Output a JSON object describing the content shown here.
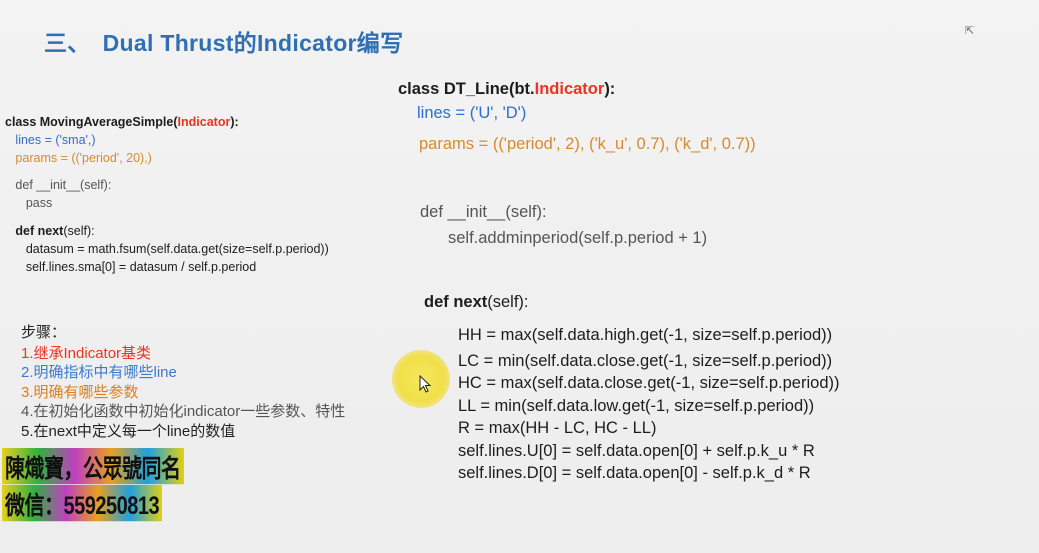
{
  "title": {
    "number": "三、",
    "text": "Dual Thrust的Indicator编写"
  },
  "left_code": {
    "line1_prefix": "class MovingAverageSimple(",
    "line1_highlight": "Indicator",
    "line1_suffix": "):",
    "lines": "lines = ('sma',)",
    "params": "params = (('period', 20),)",
    "init_def": "def __init__(self):",
    "init_body": "pass",
    "next_kw": "def next",
    "next_rest": "(self):",
    "body1": "datasum = math.fsum(self.data.get(size=self.p.period))",
    "body2": "self.lines.sma[0] = datasum / self.p.period"
  },
  "right_code": {
    "class_prefix": "class DT_Line(bt.",
    "class_highlight": "Indicator",
    "class_suffix": "):",
    "lines": "lines = ('U', 'D')",
    "params": "params = (('period', 2), ('k_u', 0.7), ('k_d', 0.7))",
    "init_def": "def __init__(self):",
    "init_body": "self.addminperiod(self.p.period + 1)",
    "next_kw": "def next",
    "next_rest": "(self):",
    "body": [
      "HH = max(self.data.high.get(-1, size=self.p.period))",
      "LC = min(self.data.close.get(-1, size=self.p.period))",
      "HC = max(self.data.close.get(-1, size=self.p.period))",
      "LL = min(self.data.low.get(-1, size=self.p.period))",
      "R = max(HH - LC, HC - LL)",
      "self.lines.U[0] = self.data.open[0] + self.p.k_u * R",
      "self.lines.D[0] = self.data.open[0] - self.p.k_d * R"
    ]
  },
  "steps": {
    "heading": "步骤：",
    "items": [
      "1.继承Indicator基类",
      "2.明确指标中有哪些line",
      "3.明确有哪些参数",
      "4.在初始化函数中初始化indicator一些参数、特性",
      "5.在next中定义每一个line的数值"
    ]
  },
  "watermark": {
    "line1": "陳熾寶，公眾號同名",
    "line2": "微信：559250813"
  },
  "colors": {
    "title": "#2f6fb2",
    "keyword_red": "#ee3322",
    "blue": "#2e6dd0",
    "orange": "#d98a2c"
  },
  "icons": [
    "mouse-pointer-icon",
    "cursor-highlight"
  ]
}
